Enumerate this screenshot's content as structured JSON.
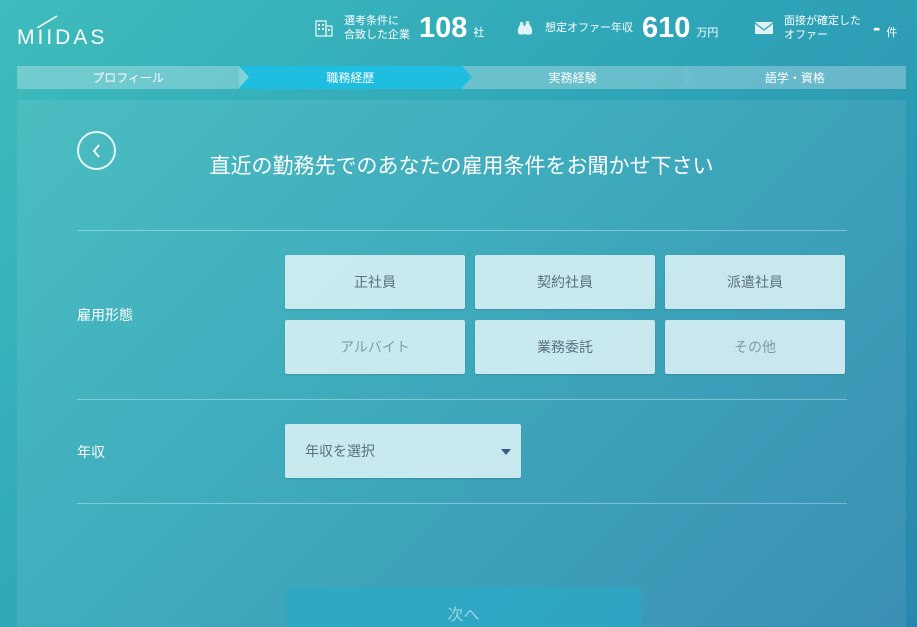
{
  "header": {
    "logo_text": "MIIDAS",
    "stats": [
      {
        "icon": "building-icon",
        "label_line1": "選考条件に",
        "label_line2": "合致した企業",
        "value": "108",
        "unit": "社"
      },
      {
        "icon": "money-bag-icon",
        "label_line1": "想定オファー年収",
        "label_line2": "",
        "value": "610",
        "unit": "万円"
      },
      {
        "icon": "mail-icon",
        "label_line1": "面接が確定した",
        "label_line2": "オファー",
        "value": "-",
        "unit": "件"
      }
    ]
  },
  "steps": [
    {
      "label": "プロフィール",
      "state": "inactive"
    },
    {
      "label": "職務経歴",
      "state": "active"
    },
    {
      "label": "実務経験",
      "state": "inactive"
    },
    {
      "label": "語学・資格",
      "state": "inactive"
    }
  ],
  "form": {
    "title": "直近の勤務先でのあなたの雇用条件をお聞かせ下さい",
    "employment": {
      "label": "雇用形態",
      "options": [
        "正社員",
        "契約社員",
        "派遣社員",
        "アルバイト",
        "業務委託",
        "その他"
      ]
    },
    "income": {
      "label": "年収",
      "placeholder": "年収を選択"
    },
    "next_label": "次へ"
  },
  "colors": {
    "step_active": "#1fbde0",
    "accent_dark": "#3a5a8a"
  }
}
